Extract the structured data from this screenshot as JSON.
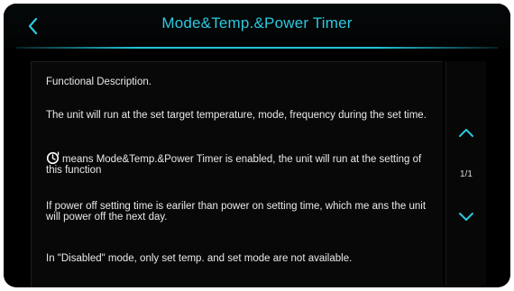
{
  "header": {
    "title": "Mode&Temp.&Power Timer",
    "back_icon": "chevron-left-icon",
    "accent_color": "#2bc9df"
  },
  "content": {
    "paragraphs": [
      "Functional Description.",
      "The unit will run at the set target temperature, mode, frequency during the set time.",
      "means Mode&Temp.&Power Timer is enabled, the unit will run at the setting of this function",
      "If power off setting time is eariler than power on setting time, which me ans the unit will power off the next day.",
      "In \"Disabled\" mode, only set temp. and set mode are not available."
    ],
    "inline_icon": "timer-icon"
  },
  "pagination": {
    "page_indicator": "1/1",
    "up_icon": "chevron-up-icon",
    "down_icon": "chevron-down-icon"
  }
}
